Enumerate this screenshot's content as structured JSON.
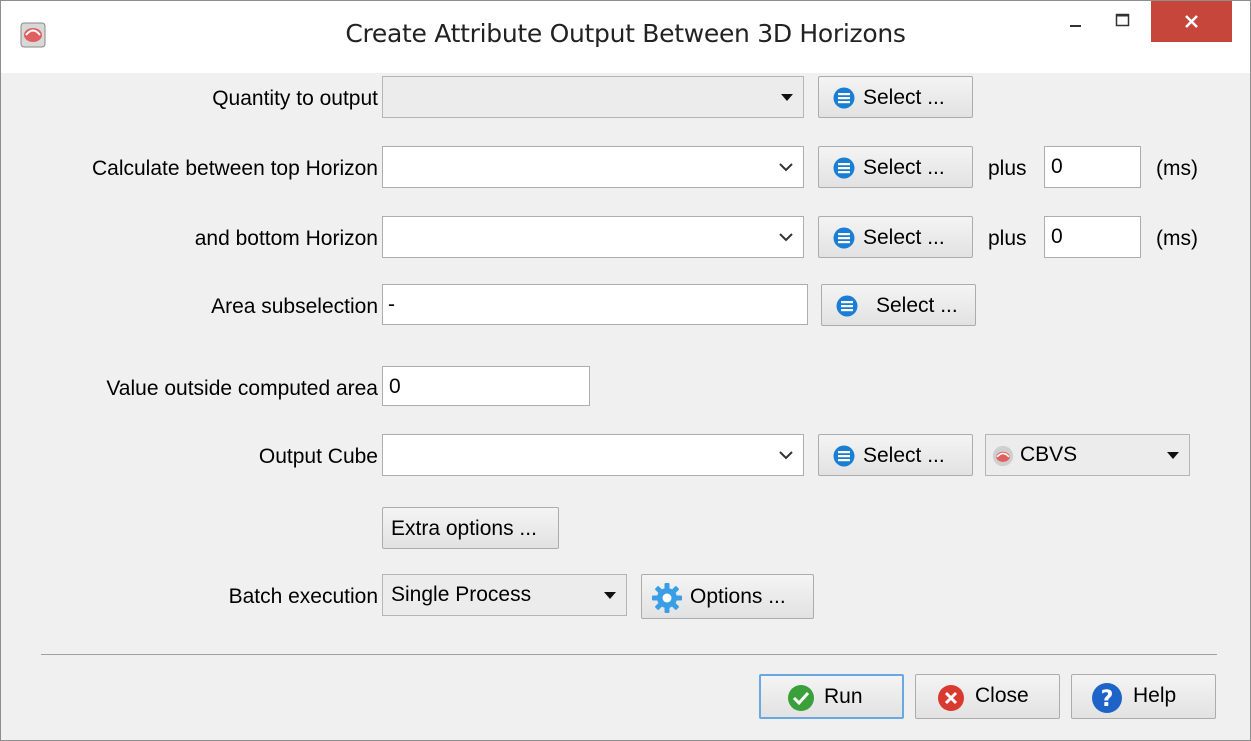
{
  "window": {
    "title": "Create Attribute Output Between 3D Horizons"
  },
  "form": {
    "quantity": {
      "label": "Quantity to output",
      "value": "",
      "select_label": "Select ..."
    },
    "top_horizon": {
      "label": "Calculate between top Horizon",
      "value": "",
      "select_label": "Select ...",
      "plus_label": "plus",
      "plus_value": "0",
      "unit": "(ms)"
    },
    "bottom_horizon": {
      "label": "and bottom Horizon",
      "value": "",
      "select_label": "Select ...",
      "plus_label": "plus",
      "plus_value": "0",
      "unit": "(ms)"
    },
    "area": {
      "label": "Area subselection",
      "value": "-",
      "select_label": "Select ..."
    },
    "outside": {
      "label": "Value outside computed area",
      "value": "0"
    },
    "output_cube": {
      "label": "Output Cube",
      "value": "",
      "select_label": "Select ...",
      "format": "CBVS"
    },
    "extra_options_label": "Extra options ...",
    "batch": {
      "label": "Batch execution",
      "value": "Single Process",
      "options_label": "Options ..."
    }
  },
  "footer": {
    "run_label": "Run",
    "close_label": "Close",
    "help_label": "Help"
  },
  "colors": {
    "list_icon": "#1a7fd4",
    "run_green": "#3aa03a",
    "close_red": "#d93a2f",
    "help_blue": "#1e64c8",
    "close_button": "#c7463c"
  }
}
